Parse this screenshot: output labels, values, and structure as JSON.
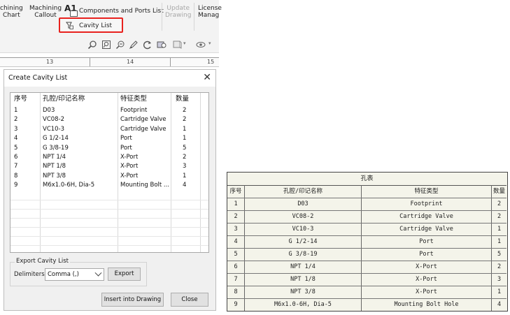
{
  "ribbon": {
    "machining_chart_line1": "chining",
    "machining_chart_line2": "Chart",
    "machining_callout_line1": "Machining",
    "machining_callout_line2": "Callout",
    "a1_label": "A1",
    "components_ports_list": "Components and Ports List",
    "cavity_list": "Cavity List",
    "update_drawing_line1": "Update",
    "update_drawing_line2": "Drawing",
    "license_line1": "License",
    "license_line2": "Manag",
    "highlight_color": "#e8221e"
  },
  "ruler": {
    "labels": [
      "13",
      "14",
      "15"
    ]
  },
  "dialog": {
    "title": "Create Cavity List",
    "close_glyph": "✕",
    "columns": [
      "序号",
      "孔腔/印记名称",
      "特征类型",
      "数量"
    ],
    "rows": [
      [
        "1",
        "D03",
        "Footprint",
        "2"
      ],
      [
        "2",
        "VC08-2",
        "Cartridge Valve",
        "2"
      ],
      [
        "3",
        "VC10-3",
        "Cartridge Valve",
        "1"
      ],
      [
        "4",
        "G 1/2-14",
        "Port",
        "1"
      ],
      [
        "5",
        "G 3/8-19",
        "Port",
        "5"
      ],
      [
        "6",
        "NPT 1/4",
        "X-Port",
        "2"
      ],
      [
        "7",
        "NPT 1/8",
        "X-Port",
        "3"
      ],
      [
        "8",
        "NPT 3/8",
        "X-Port",
        "1"
      ],
      [
        "9",
        "M6x1.0-6H, Dia-5",
        "Mounting Bolt ...",
        "4"
      ]
    ],
    "export_group": "Export Cavity List",
    "delimiters_label": "Delimiters",
    "delimiter_value": "Comma (,)",
    "export_button": "Export",
    "insert_button": "Insert into Drawing",
    "close_button": "Close"
  },
  "hole_table": {
    "title": "孔表",
    "columns": [
      "序号",
      "孔腔/印记名称",
      "特征类型",
      "数量"
    ],
    "rows": [
      [
        "1",
        "D03",
        "Footprint",
        "2"
      ],
      [
        "2",
        "VC08-2",
        "Cartridge Valve",
        "2"
      ],
      [
        "3",
        "VC10-3",
        "Cartridge Valve",
        "1"
      ],
      [
        "4",
        "G 1/2-14",
        "Port",
        "1"
      ],
      [
        "5",
        "G 3/8-19",
        "Port",
        "5"
      ],
      [
        "6",
        "NPT 1/4",
        "X-Port",
        "2"
      ],
      [
        "7",
        "NPT 1/8",
        "X-Port",
        "3"
      ],
      [
        "8",
        "NPT 3/8",
        "X-Port",
        "1"
      ],
      [
        "9",
        "M6x1.0-6H, Dia-5",
        "Mounting Bolt Hole",
        "4"
      ]
    ],
    "background_color": "#f4f4ea"
  }
}
